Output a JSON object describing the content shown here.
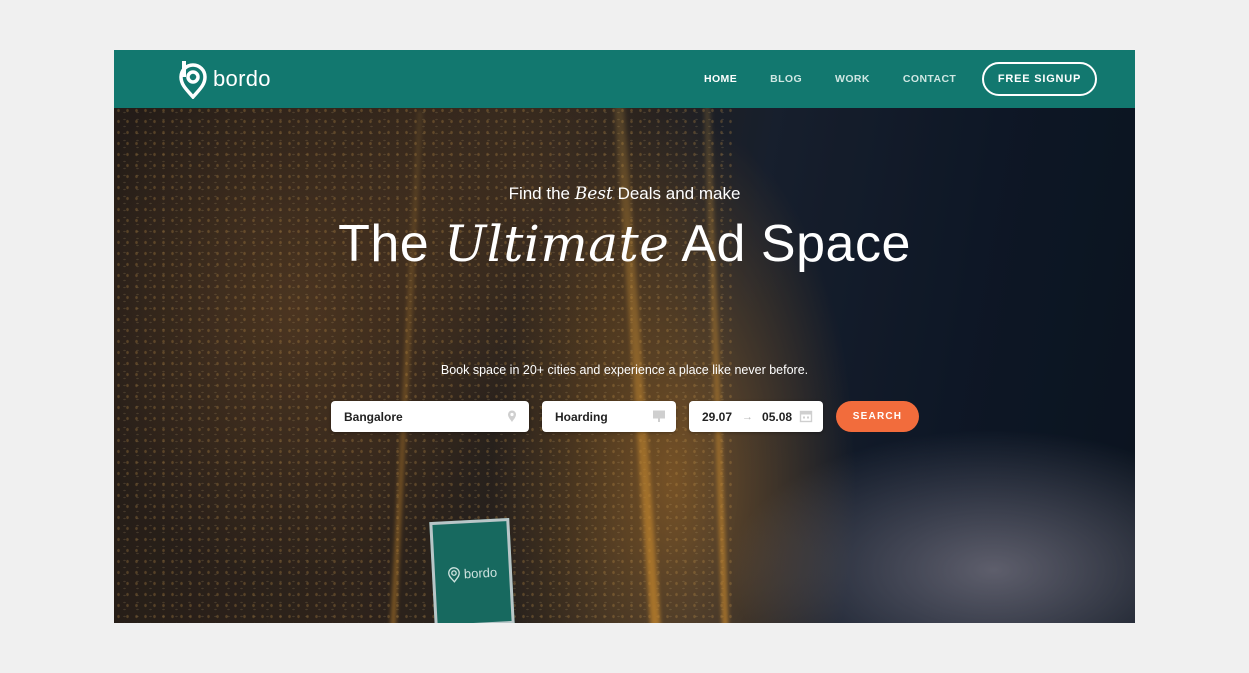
{
  "brand": {
    "name": "bordo",
    "accent": "#12786f",
    "cta_color": "#f26c3c"
  },
  "nav": {
    "items": [
      {
        "label": "HOME",
        "active": true
      },
      {
        "label": "BLOG",
        "active": false
      },
      {
        "label": "WORK",
        "active": false
      },
      {
        "label": "CONTACT",
        "active": false
      }
    ],
    "signup_label": "FREE SIGNUP"
  },
  "hero": {
    "tagline_pre": "Find the",
    "tagline_em": "Best",
    "tagline_post": "Deals and make",
    "headline_pre": "The",
    "headline_em": "Ultimate",
    "headline_post": "Ad Space",
    "subtext": "Book space in 20+ cities  and experience a place like never before.",
    "billboard_text": "bordo"
  },
  "search": {
    "location_value": "Bangalore",
    "location_icon": "map-pin-icon",
    "type_value": "Hoarding",
    "type_icon": "billboard-icon",
    "date_from": "29.07",
    "date_arrow": "→",
    "date_to": "05.08",
    "date_icon": "calendar-icon",
    "button_label": "SEARCH"
  }
}
